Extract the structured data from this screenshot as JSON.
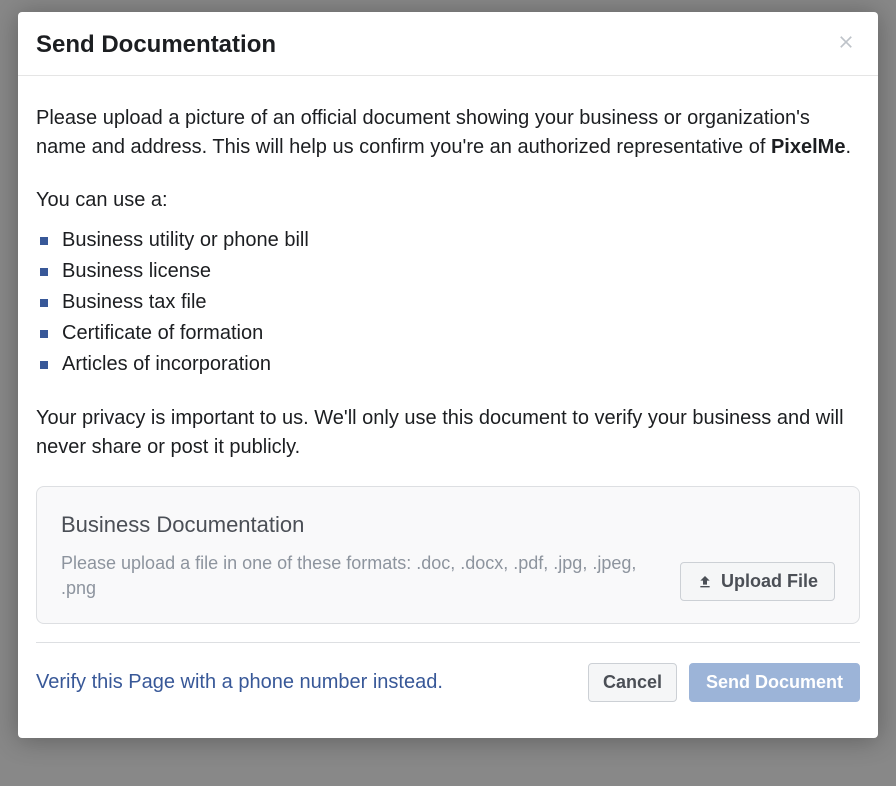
{
  "modal": {
    "title": "Send Documentation",
    "intro_prefix": "Please upload a picture of an official document showing your business or organization's name and address. This will help us confirm you're an authorized representative of ",
    "intro_bold": "PixelMe",
    "intro_suffix": ".",
    "uses_line": "You can use a:",
    "documents": [
      "Business utility or phone bill",
      "Business license",
      "Business tax file",
      "Certificate of formation",
      "Articles of incorporation"
    ],
    "privacy": "Your privacy is important to us. We'll only use this document to verify your business and will never share or post it publicly.",
    "upload": {
      "title": "Business Documentation",
      "desc": "Please upload a file in one of these formats: .doc, .docx, .pdf, .jpg, .jpeg, .png",
      "button": "Upload File"
    },
    "alt_link": "Verify this Page with a phone number instead.",
    "cancel": "Cancel",
    "send": "Send Document"
  }
}
